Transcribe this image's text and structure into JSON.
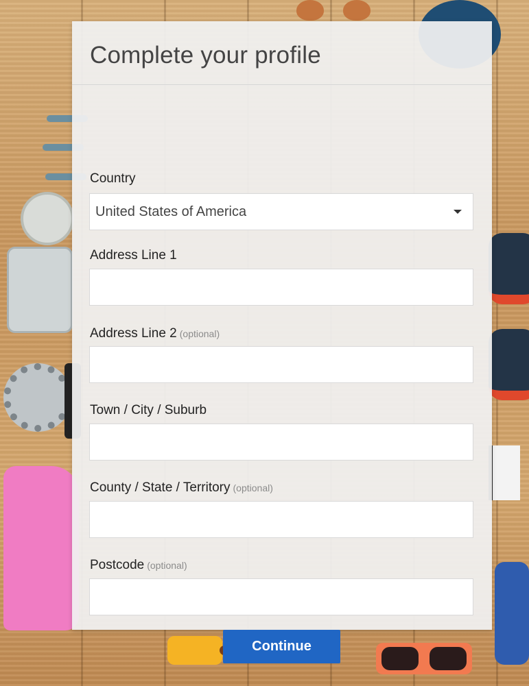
{
  "form": {
    "title": "Complete your profile",
    "country": {
      "label": "Country",
      "selected": "United States of America"
    },
    "address1": {
      "label": "Address Line 1",
      "value": ""
    },
    "address2": {
      "label": "Address Line 2",
      "optional": "(optional)",
      "value": ""
    },
    "city": {
      "label": "Town / City / Suburb",
      "value": ""
    },
    "state": {
      "label": "County / State / Territory",
      "optional": "(optional)",
      "value": ""
    },
    "postcode": {
      "label": "Postcode",
      "optional": "(optional)",
      "value": ""
    },
    "continue_label": "Continue"
  },
  "colors": {
    "accent": "#2066c4",
    "card": "#f0f0f0"
  },
  "icons": {
    "select_caret": "chevron-down-icon"
  }
}
